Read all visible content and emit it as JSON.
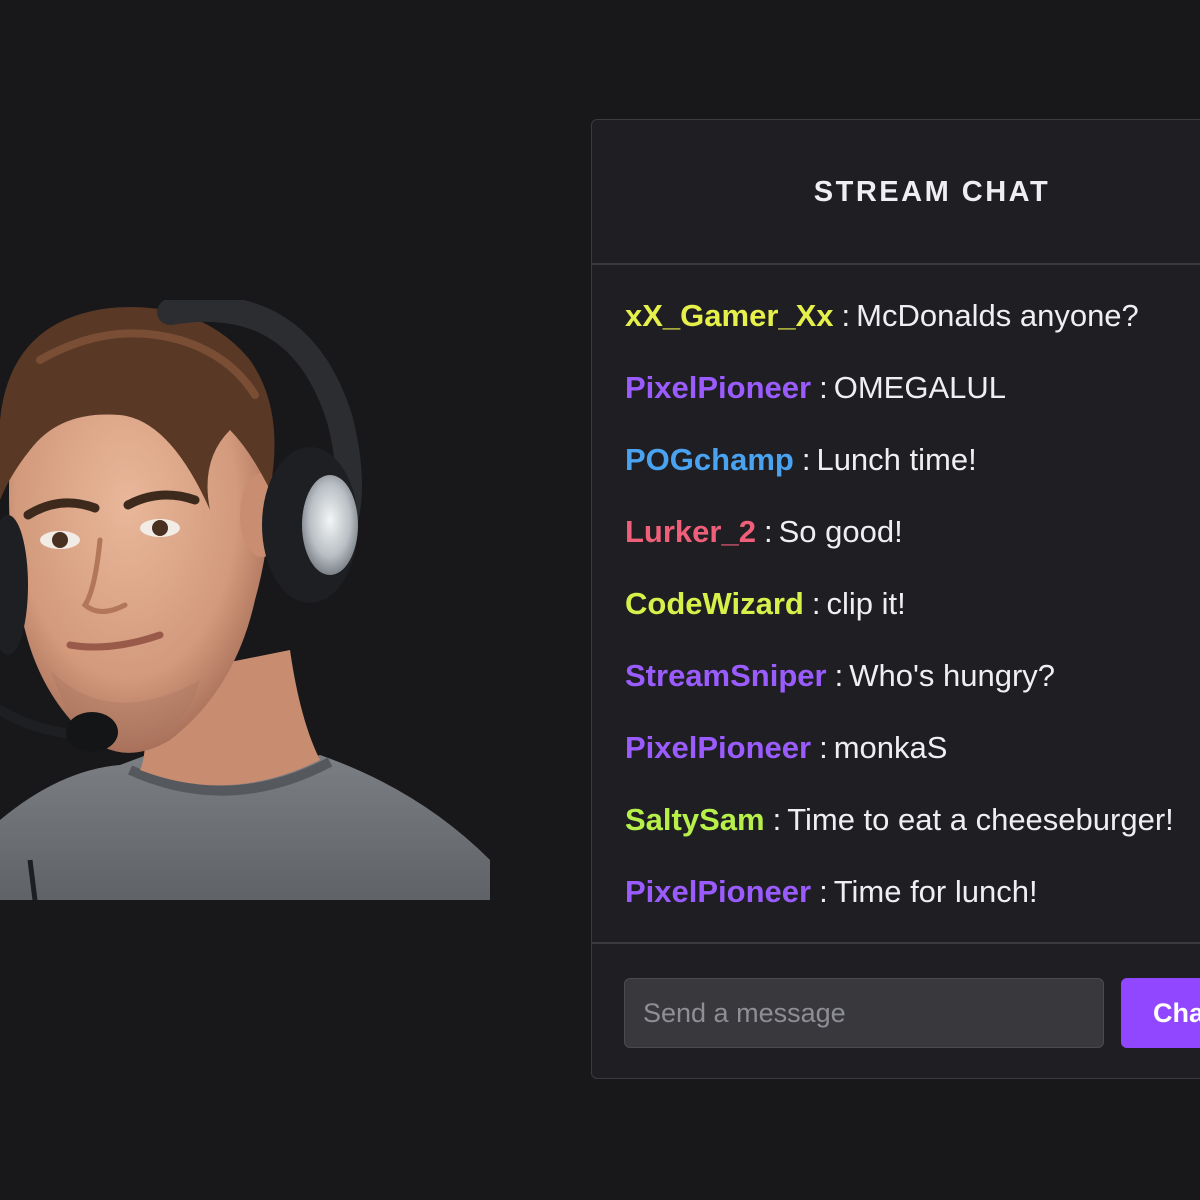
{
  "chat": {
    "title": "STREAM CHAT",
    "messages": [
      {
        "user": "xX_Gamer_Xx",
        "user_color": "#e6f04a",
        "text": "McDonalds anyone?"
      },
      {
        "user": "PixelPioneer",
        "user_color": "#9b5cff",
        "text": "OMEGALUL"
      },
      {
        "user": "POGchamp",
        "user_color": "#4aa3f0",
        "text": "Lunch time!"
      },
      {
        "user": "Lurker_2",
        "user_color": "#ef5f7a",
        "text": "So good!"
      },
      {
        "user": "CodeWizard",
        "user_color": "#d8f04a",
        "text": "clip it!"
      },
      {
        "user": "StreamSniper",
        "user_color": "#9b5cff",
        "text": "Who's hungry?"
      },
      {
        "user": "PixelPioneer",
        "user_color": "#9b5cff",
        "text": "monkaS"
      },
      {
        "user": "SaltySam",
        "user_color": "#b8f04a",
        "text": "Time to eat a cheeseburger!"
      },
      {
        "user": "PixelPioneer",
        "user_color": "#9b5cff",
        "text": "Time for lunch!"
      }
    ],
    "input": {
      "placeholder": "Send a message",
      "value": ""
    },
    "send_label": "Chat"
  },
  "colors": {
    "background": "#18181b",
    "panel": "#1f1f23",
    "accent": "#9147ff"
  }
}
